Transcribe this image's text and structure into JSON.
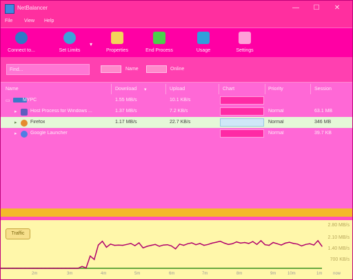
{
  "window": {
    "title": "NetBalancer",
    "controls": {
      "minimize": "—",
      "maximize": "☐",
      "close": "✕"
    }
  },
  "menu": [
    "File",
    "View",
    "Help"
  ],
  "toolbar": [
    {
      "label": "Connect to..."
    },
    {
      "label": "Set Limits"
    },
    {
      "label": "Properties"
    },
    {
      "label": "End Process"
    },
    {
      "label": "Usage"
    },
    {
      "label": "Settings"
    }
  ],
  "filter": {
    "search_placeholder": "Find...",
    "toggle_name_label": "Name",
    "toggle_online_label": "Online"
  },
  "table": {
    "headers": [
      "Name",
      "Download",
      "Upload",
      "Chart",
      "Priority",
      "Session"
    ],
    "rows": [
      {
        "name": "MYPC",
        "download": "1.55 MB/s",
        "upload": "10.1 KB/s",
        "priority": "",
        "session": ""
      },
      {
        "name": "Host Process for Windows ...",
        "download": "1.37 MB/s",
        "upload": "7.2 KB/s",
        "priority": "Normal",
        "session": "63.1 MB"
      },
      {
        "name": "Firefox",
        "download": "1.17 MB/s",
        "upload": "22.7 KB/s",
        "priority": "Normal",
        "session": "346 MB"
      },
      {
        "name": "Google Launcher",
        "download": "",
        "upload": "",
        "priority": "Normal",
        "session": "39.7 KB"
      }
    ]
  },
  "chart": {
    "badge": "Traffic",
    "y_labels": [
      "2.80 MB/s",
      "2.10 MB/s",
      "1.40 MB/s",
      "700 KB/s"
    ],
    "x_labels": [
      "2m",
      "3m",
      "4m",
      "5m",
      "6m",
      "7m",
      "8m",
      "9m",
      "10m",
      "1m",
      "now"
    ],
    "line_color": "#b0006c"
  },
  "chart_data": {
    "type": "line",
    "series": [
      {
        "values": [
          0.0,
          0.0,
          0.0,
          0.0,
          0.0,
          0.0,
          0.0,
          0.0,
          0.0,
          0.0,
          0.0,
          0.0,
          0.0,
          0.0,
          0.0,
          0.0,
          0.0,
          0.0,
          0.0,
          0.0,
          0.12,
          0.02,
          0.78,
          0.56,
          1.48,
          1.72,
          1.34,
          1.54,
          1.46,
          1.48,
          1.46,
          1.52,
          1.58,
          1.44,
          1.62,
          1.3,
          1.4,
          1.46,
          1.52,
          1.4,
          1.48,
          1.5,
          1.42,
          1.24,
          1.54,
          1.46,
          1.56,
          1.62,
          1.5,
          1.58,
          1.46,
          1.52,
          1.6,
          1.66,
          1.72,
          1.6,
          1.52,
          1.56,
          1.68,
          1.6,
          1.64,
          1.58,
          1.7,
          1.52,
          1.76,
          1.5,
          1.46,
          1.64,
          1.56,
          1.48,
          1.6,
          1.66,
          1.58,
          1.54,
          1.42,
          1.52,
          1.56,
          1.48,
          1.76,
          1.4
        ]
      }
    ],
    "ylim": [
      0,
      2.8
    ]
  }
}
